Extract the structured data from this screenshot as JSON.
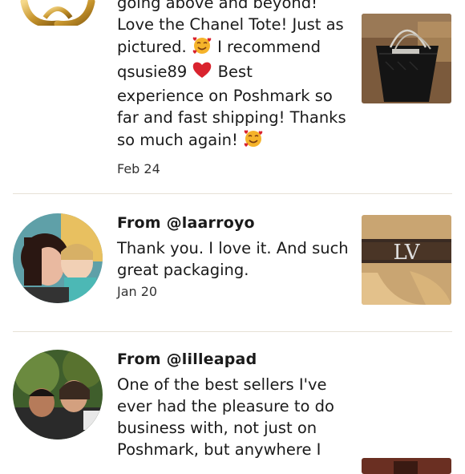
{
  "reviews": [
    {
      "body_lines": [
        "going above and beyond!",
        "Love the Chanel Tote! Just as",
        [
          "pictured. ",
          "{smile}",
          " I recommend"
        ],
        [
          "qsusie89 ",
          "{heart}",
          " Best"
        ],
        "experience on Poshmark so",
        "far and fast shipping! Thanks",
        [
          "so much again! ",
          "{smile}"
        ]
      ],
      "date": "Feb 24"
    },
    {
      "from": "From @laarroyo",
      "body_lines": [
        "Thank you. I love it. And such",
        "great packaging."
      ],
      "date": "Jan 20"
    },
    {
      "from": "From @lilleapad",
      "body_lines": [
        "One of the best sellers I've",
        "ever had the pleasure to do",
        "business with, not just on",
        "Poshmark, but anywhere I"
      ]
    }
  ],
  "colors": {
    "divider": "#e6e1d6",
    "heart": "#d9232e",
    "smile": "#f5b32a"
  }
}
